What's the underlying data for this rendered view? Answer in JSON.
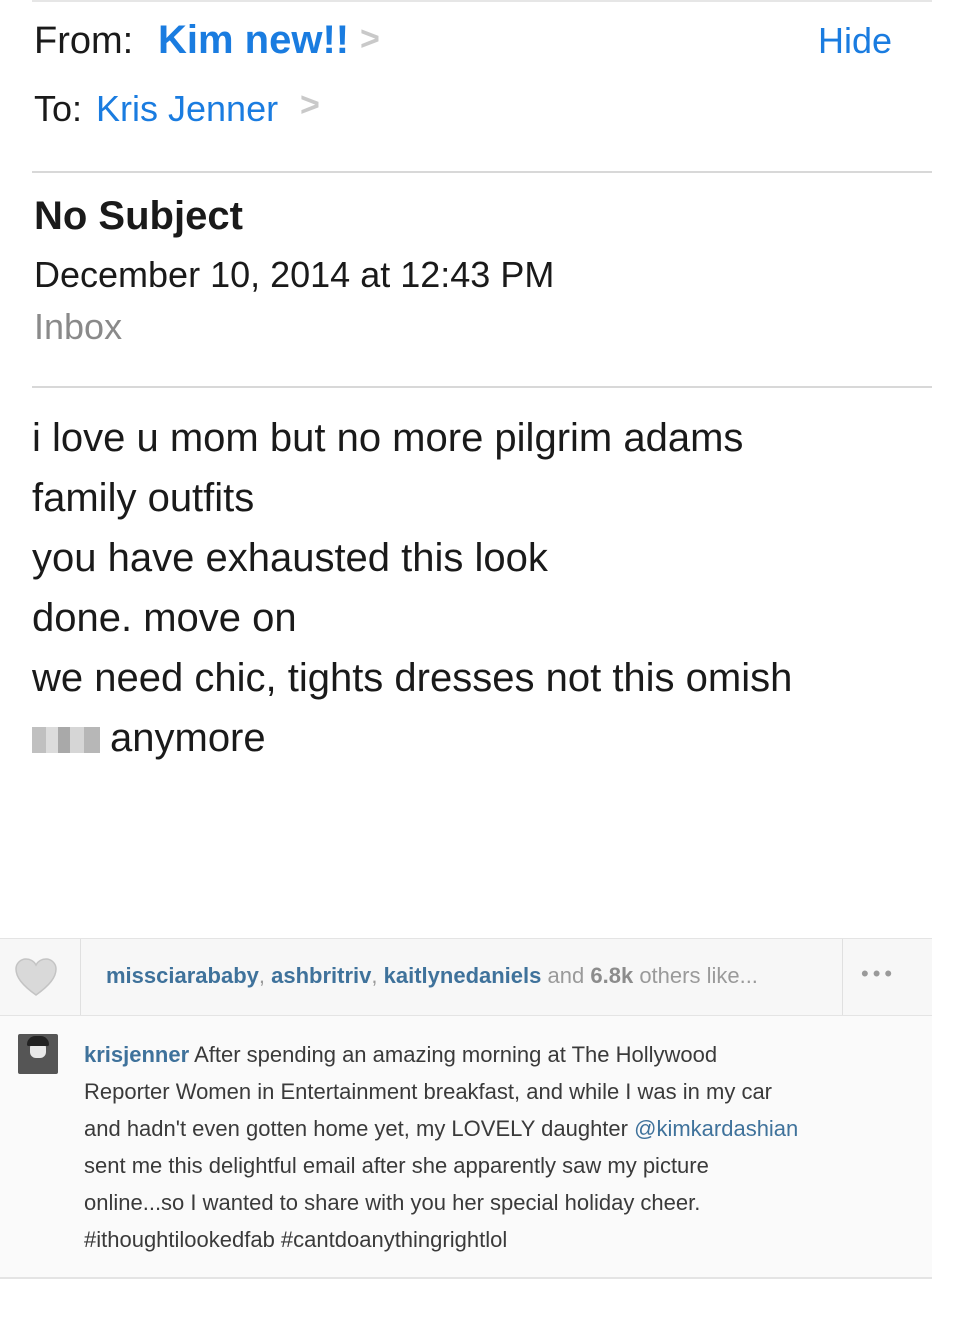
{
  "header": {
    "from_label": "From:",
    "from_name": "Kim new!!",
    "hide_label": "Hide",
    "to_label": "To:",
    "to_name": "Kris Jenner",
    "chevron": ">"
  },
  "message": {
    "subject": "No Subject",
    "date": "December 10, 2014 at 12:43 PM",
    "folder": "Inbox",
    "body_lines": [
      "i love u mom but no more pilgrim adams",
      "family outfits",
      "you have exhausted this look",
      "done. move on",
      "we need chic, tights dresses not this omish",
      "anymore"
    ]
  },
  "instagram": {
    "likes": {
      "users": [
        "missciarababy",
        "ashbritriv",
        "kaitlynedaniels"
      ],
      "comma": ",",
      "and_text": "and",
      "count": "6.8k",
      "others_text": "others like..."
    },
    "more_label": "•••",
    "caption": {
      "username": "krisjenner",
      "line1": "After spending an amazing morning at The Hollywood",
      "line2": "Reporter Women in Entertainment breakfast, and while I was in my car",
      "line3_prefix": "and hadn't even gotten home yet, my LOVELY daughter",
      "mention": "@kimkardashian",
      "line4": "sent me this delightful email after she apparently saw my picture",
      "line5": "online...so I wanted to share with you her special holiday cheer.",
      "line6": "#ithoughtilookedfab #cantdoanythingrightlol"
    }
  },
  "colors": {
    "link_blue": "#1a7ce0",
    "instagram_blue": "#3f729b",
    "muted_gray": "#8a8a8a"
  }
}
